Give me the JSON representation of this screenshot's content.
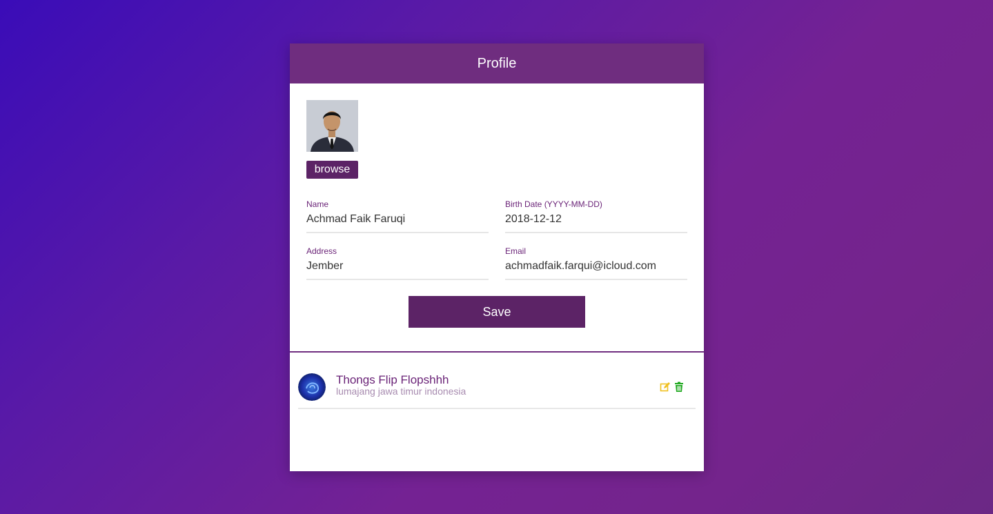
{
  "header": {
    "title": "Profile"
  },
  "photo": {
    "browse_label": "browse"
  },
  "form": {
    "name": {
      "label": "Name",
      "value": "Achmad Faik Faruqi"
    },
    "birth_date": {
      "label": "Birth Date (YYYY-MM-DD)",
      "value": "2018-12-12"
    },
    "address": {
      "label": "Address",
      "value": "Jember"
    },
    "email": {
      "label": "Email",
      "value": "achmadfaik.farqui@icloud.com"
    },
    "save_label": "Save"
  },
  "list": {
    "items": [
      {
        "title": "Thongs Flip Flopshhh",
        "subtitle": "lumajang jawa timur indonesia",
        "actions": {
          "edit_icon": "edit-icon",
          "delete_icon": "trash-icon"
        }
      }
    ]
  },
  "colors": {
    "accent": "#5c2366",
    "header": "#6f2d7f",
    "label": "#6a2377",
    "edit": "#f0c020",
    "delete": "#1fa81f"
  }
}
